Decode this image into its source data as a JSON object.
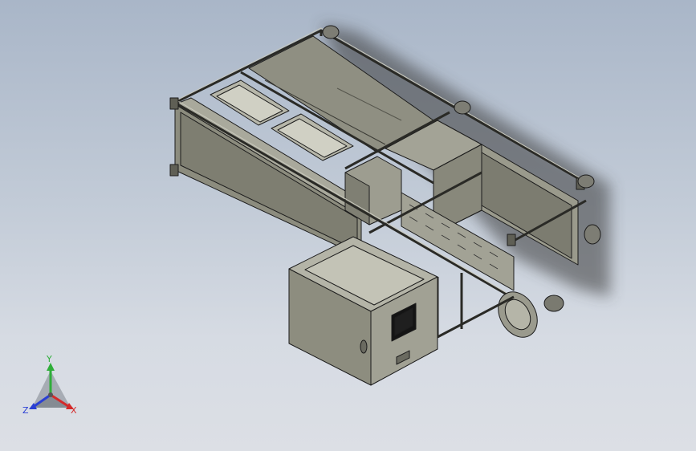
{
  "viewport": {
    "background_top": "#a9b6c8",
    "background_bottom": "#dcdfe5"
  },
  "model": {
    "body_color": "#8e8e80",
    "body_light": "#b2b2a4",
    "body_dark": "#5f5f55",
    "edge_color": "#1c1c1c"
  },
  "triad": {
    "x_label": "X",
    "y_label": "Y",
    "z_label": "Z",
    "x_color": "#d42a2a",
    "y_color": "#2fae3a",
    "z_color": "#2a3fd4"
  }
}
